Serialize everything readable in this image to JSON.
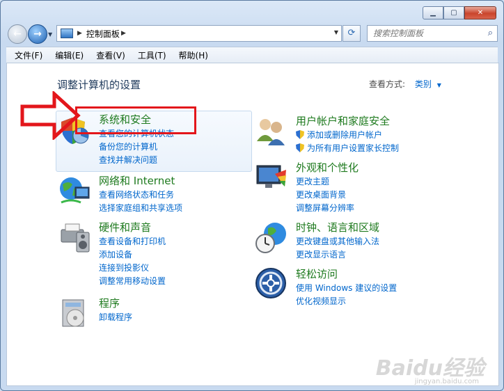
{
  "window": {
    "breadcrumb": "控制面板",
    "search_placeholder": "搜索控制面板"
  },
  "menu": [
    "文件(F)",
    "编辑(E)",
    "查看(V)",
    "工具(T)",
    "帮助(H)"
  ],
  "page": {
    "title": "调整计算机的设置",
    "view_by_label": "查看方式:",
    "view_by_value": "类别"
  },
  "categories": [
    {
      "title": "系统和安全",
      "links": [
        "查看您的计算机状态",
        "备份您的计算机",
        "查找并解决问题"
      ]
    },
    {
      "title": "网络和 Internet",
      "links": [
        "查看网络状态和任务",
        "选择家庭组和共享选项"
      ]
    },
    {
      "title": "硬件和声音",
      "links": [
        "查看设备和打印机",
        "添加设备",
        "连接到投影仪",
        "调整常用移动设置"
      ]
    },
    {
      "title": "程序",
      "links": [
        "卸载程序"
      ]
    },
    {
      "title": "用户帐户和家庭安全",
      "links": [
        "添加或删除用户帐户",
        "为所有用户设置家长控制"
      ]
    },
    {
      "title": "外观和个性化",
      "links": [
        "更改主题",
        "更改桌面背景",
        "调整屏幕分辨率"
      ]
    },
    {
      "title": "时钟、语言和区域",
      "links": [
        "更改键盘或其他输入法",
        "更改显示语言"
      ]
    },
    {
      "title": "轻松访问",
      "links": [
        "使用 Windows 建议的设置",
        "优化视频显示"
      ]
    }
  ],
  "watermark": {
    "text": "Baidu经验",
    "sub": "jingyan.baidu.com"
  },
  "colors": {
    "link": "#0066cc",
    "category_title": "#1e7a1e",
    "highlight_box": "#e3161b"
  }
}
